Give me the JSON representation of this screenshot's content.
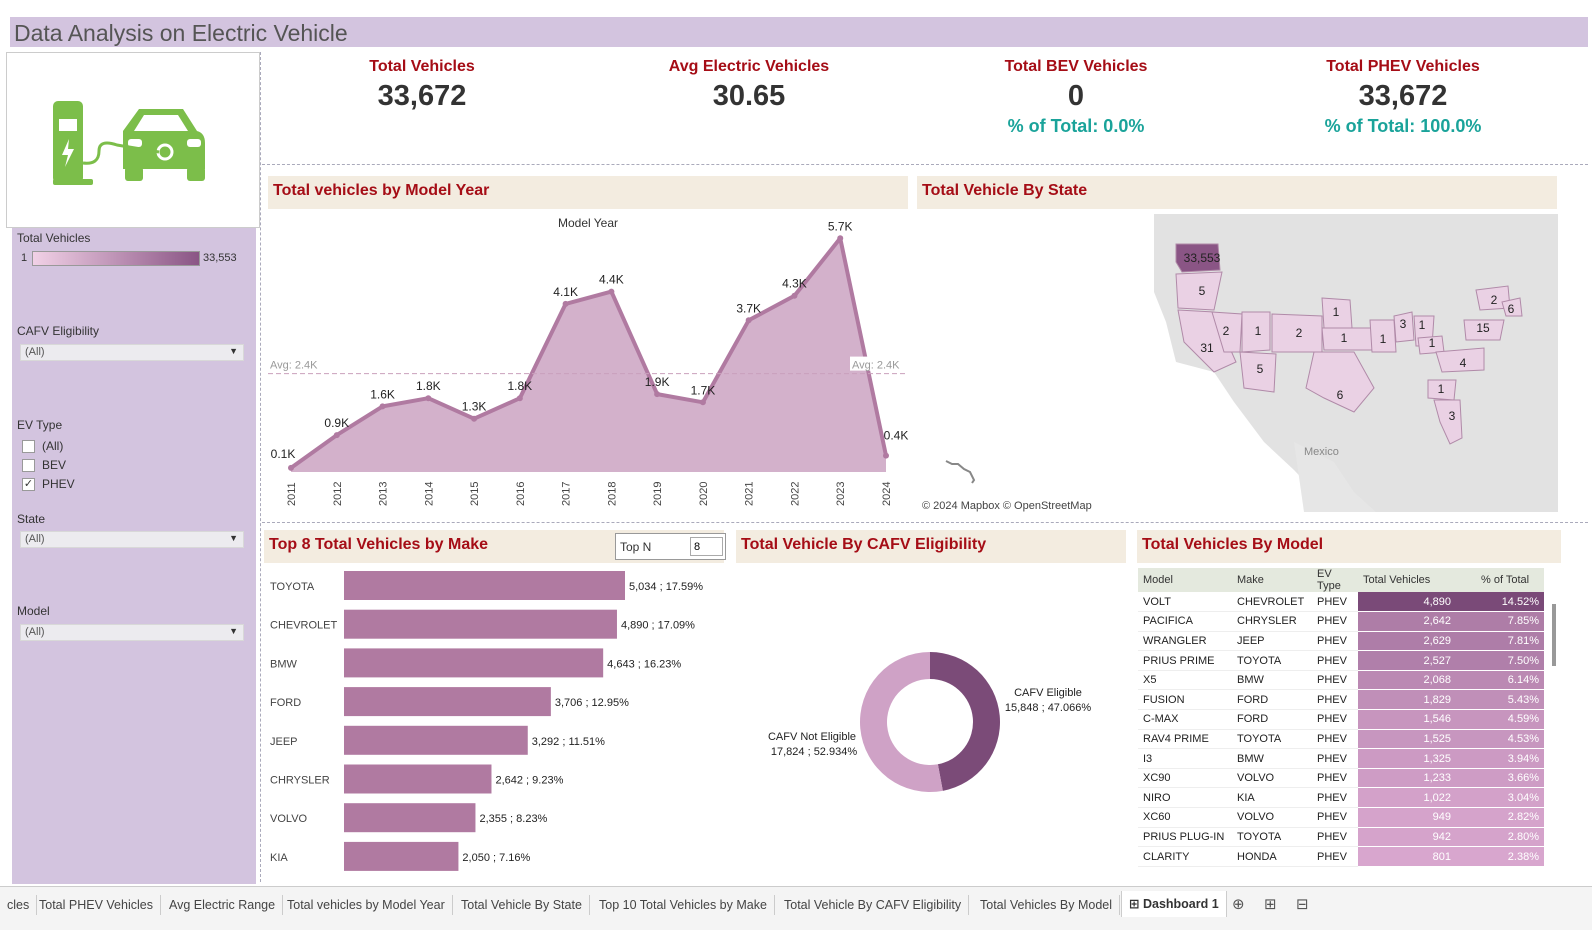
{
  "title": "Data Analysis on Electric Vehicle",
  "colors": {
    "accent": "#a50d16",
    "teal": "#1aa39a",
    "purple": "#b07aa1",
    "sidebar": "#d3c4df",
    "panel_header": "#f3ece0"
  },
  "kpis": [
    {
      "label": "Total Vehicles",
      "value": "33,672",
      "pct": ""
    },
    {
      "label": "Avg Electric Vehicles",
      "value": "30.65",
      "pct": ""
    },
    {
      "label": "Total BEV Vehicles",
      "value": "0",
      "pct": "% of Total: 0.0%"
    },
    {
      "label": "Total PHEV Vehicles",
      "value": "33,672",
      "pct": "% of Total: 100.0%"
    }
  ],
  "sidebar": {
    "legend_title": "Total Vehicles",
    "legend_min": "1",
    "legend_max": "33,553",
    "cafv_label": "CAFV Eligibility",
    "cafv_value": "(All)",
    "ev_type_label": "EV Type",
    "ev_options": [
      {
        "label": "(All)",
        "checked": false
      },
      {
        "label": "BEV",
        "checked": false
      },
      {
        "label": "PHEV",
        "checked": true
      }
    ],
    "state_label": "State",
    "state_value": "(All)",
    "model_label": "Model",
    "model_value": "(All)"
  },
  "panels": {
    "model_year": "Total vehicles by Model Year",
    "state": "Total Vehicle By State",
    "make": "Top 8 Total Vehicles by Make",
    "cafv": "Total Vehicle By CAFV Eligibility",
    "model": "Total Vehicles By Model"
  },
  "topn": {
    "label": "Top N",
    "value": "8"
  },
  "map": {
    "copyright": "© 2024 Mapbox © OpenStreetMap",
    "country_label": "Mexico",
    "state_values": [
      "33,553",
      "5",
      "31",
      "2",
      "1",
      "5",
      "2",
      "1",
      "1",
      "6",
      "1",
      "3",
      "1",
      "1",
      "4",
      "1",
      "3",
      "15",
      "2",
      "6"
    ]
  },
  "chart_data": [
    {
      "type": "area",
      "title": "Total vehicles by Model Year",
      "xlabel": "Model Year",
      "x": [
        "2011",
        "2012",
        "2013",
        "2014",
        "2015",
        "2016",
        "2017",
        "2018",
        "2019",
        "2020",
        "2021",
        "2022",
        "2023",
        "2024"
      ],
      "values": [
        100,
        900,
        1600,
        1800,
        1300,
        1800,
        4100,
        4400,
        1900,
        1700,
        3700,
        4300,
        5700,
        400
      ],
      "data_labels": [
        "0.1K",
        "0.9K",
        "1.6K",
        "1.8K",
        "1.3K",
        "1.8K",
        "4.1K",
        "4.4K",
        "1.9K",
        "1.7K",
        "3.7K",
        "4.3K",
        "5.7K",
        "0.4K"
      ],
      "ylim": [
        0,
        6000
      ],
      "reference_line": {
        "value": 2400,
        "label": "Avg: 2.4K"
      }
    },
    {
      "type": "bar",
      "title": "Top 8 Total Vehicles by Make",
      "orientation": "horizontal",
      "categories": [
        "TOYOTA",
        "CHEVROLET",
        "BMW",
        "FORD",
        "JEEP",
        "CHRYSLER",
        "VOLVO",
        "KIA"
      ],
      "values": [
        5034,
        4890,
        4643,
        3706,
        3292,
        2642,
        2355,
        2050
      ],
      "labels": [
        "5,034 ; 17.59%",
        "4,890 ; 17.09%",
        "4,643 ; 16.23%",
        "3,706 ; 12.95%",
        "3,292 ; 11.51%",
        "2,642 ; 9.23%",
        "2,355 ; 8.23%",
        "2,050 ; 7.16%"
      ]
    },
    {
      "type": "pie",
      "title": "Total Vehicle By CAFV Eligibility",
      "categories": [
        "CAFV Eligible",
        "CAFV Not Eligible"
      ],
      "values": [
        15848,
        17824
      ],
      "labels": [
        "15,848 ; 47.066%",
        "17,824 ; 52.934%"
      ],
      "colors": [
        "#7b4b78",
        "#cfa2c6"
      ]
    },
    {
      "type": "table",
      "title": "Total Vehicles By Model",
      "columns": [
        "Model",
        "Make",
        "EV Type",
        "Total Vehicles",
        "% of Total"
      ],
      "rows": [
        [
          "VOLT",
          "CHEVROLET",
          "PHEV",
          "4,890",
          "14.52%"
        ],
        [
          "PACIFICA",
          "CHRYSLER",
          "PHEV",
          "2,642",
          "7.85%"
        ],
        [
          "WRANGLER",
          "JEEP",
          "PHEV",
          "2,629",
          "7.81%"
        ],
        [
          "PRIUS PRIME",
          "TOYOTA",
          "PHEV",
          "2,527",
          "7.50%"
        ],
        [
          "X5",
          "BMW",
          "PHEV",
          "2,068",
          "6.14%"
        ],
        [
          "FUSION",
          "FORD",
          "PHEV",
          "1,829",
          "5.43%"
        ],
        [
          "C-MAX",
          "FORD",
          "PHEV",
          "1,546",
          "4.59%"
        ],
        [
          "RAV4 PRIME",
          "TOYOTA",
          "PHEV",
          "1,525",
          "4.53%"
        ],
        [
          "I3",
          "BMW",
          "PHEV",
          "1,325",
          "3.94%"
        ],
        [
          "XC90",
          "VOLVO",
          "PHEV",
          "1,233",
          "3.66%"
        ],
        [
          "NIRO",
          "KIA",
          "PHEV",
          "1,022",
          "3.04%"
        ],
        [
          "XC60",
          "VOLVO",
          "PHEV",
          "949",
          "2.82%"
        ],
        [
          "PRIUS PLUG-IN",
          "TOYOTA",
          "PHEV",
          "942",
          "2.80%"
        ],
        [
          "CLARITY",
          "HONDA",
          "PHEV",
          "801",
          "2.38%"
        ]
      ],
      "values": [
        4890,
        2642,
        2629,
        2527,
        2068,
        1829,
        1546,
        1525,
        1325,
        1233,
        1022,
        949,
        942,
        801
      ]
    }
  ],
  "tabs": [
    "cles",
    "Total PHEV Vehicles",
    "Avg Electric Range",
    "Total vehicles by Model Year",
    "Total Vehicle By State",
    "Top 10 Total Vehicles by Make",
    "Total Vehicle By CAFV Eligibility",
    "Total Vehicles By Model",
    "Dashboard 1"
  ],
  "active_tab": "Dashboard 1"
}
